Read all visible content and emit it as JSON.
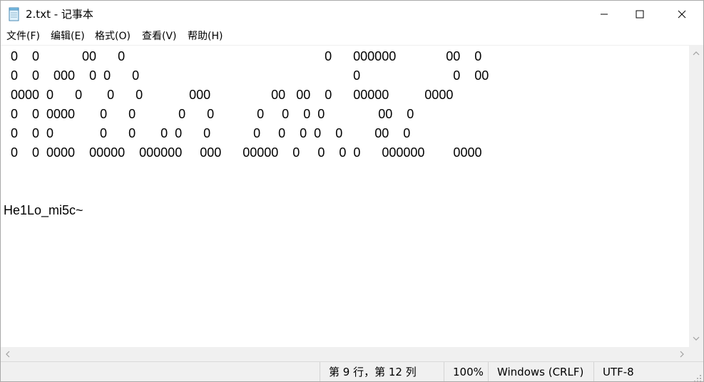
{
  "window": {
    "title": "2.txt - 记事本",
    "icons": {
      "app": "notepad-icon",
      "minimize": "minimize-icon",
      "maximize": "maximize-icon",
      "close": "close-icon"
    }
  },
  "menu": {
    "items": [
      "文件(F)",
      "编辑(E)",
      "格式(O)",
      "查看(V)",
      "帮助(H)"
    ]
  },
  "editor": {
    "lines": [
      "  0    0            00      0                                                        0      000000              00    0",
      "  0    0    000    0  0      0                                                            0                          0    00",
      "  0000  0      0       0      0             000                 00   00    0      00000          0000",
      "  0    0  0000       0      0            0      0            0     0    0  0               00    0",
      "  0    0  0             0      0       0  0      0            0     0    0  0    0         00    0",
      "  0    0  0000    00000    000000     000      00000    0     0    0  0      000000        0000",
      "",
      "",
      "He1Lo_mi5c~"
    ]
  },
  "status": {
    "position": "第 9 行，第 12 列",
    "zoom": "100%",
    "line_ending": "Windows (CRLF)",
    "encoding": "UTF-8"
  },
  "colors": {
    "chrome": "#f0f0f0",
    "text": "#000000",
    "background": "#ffffff"
  }
}
